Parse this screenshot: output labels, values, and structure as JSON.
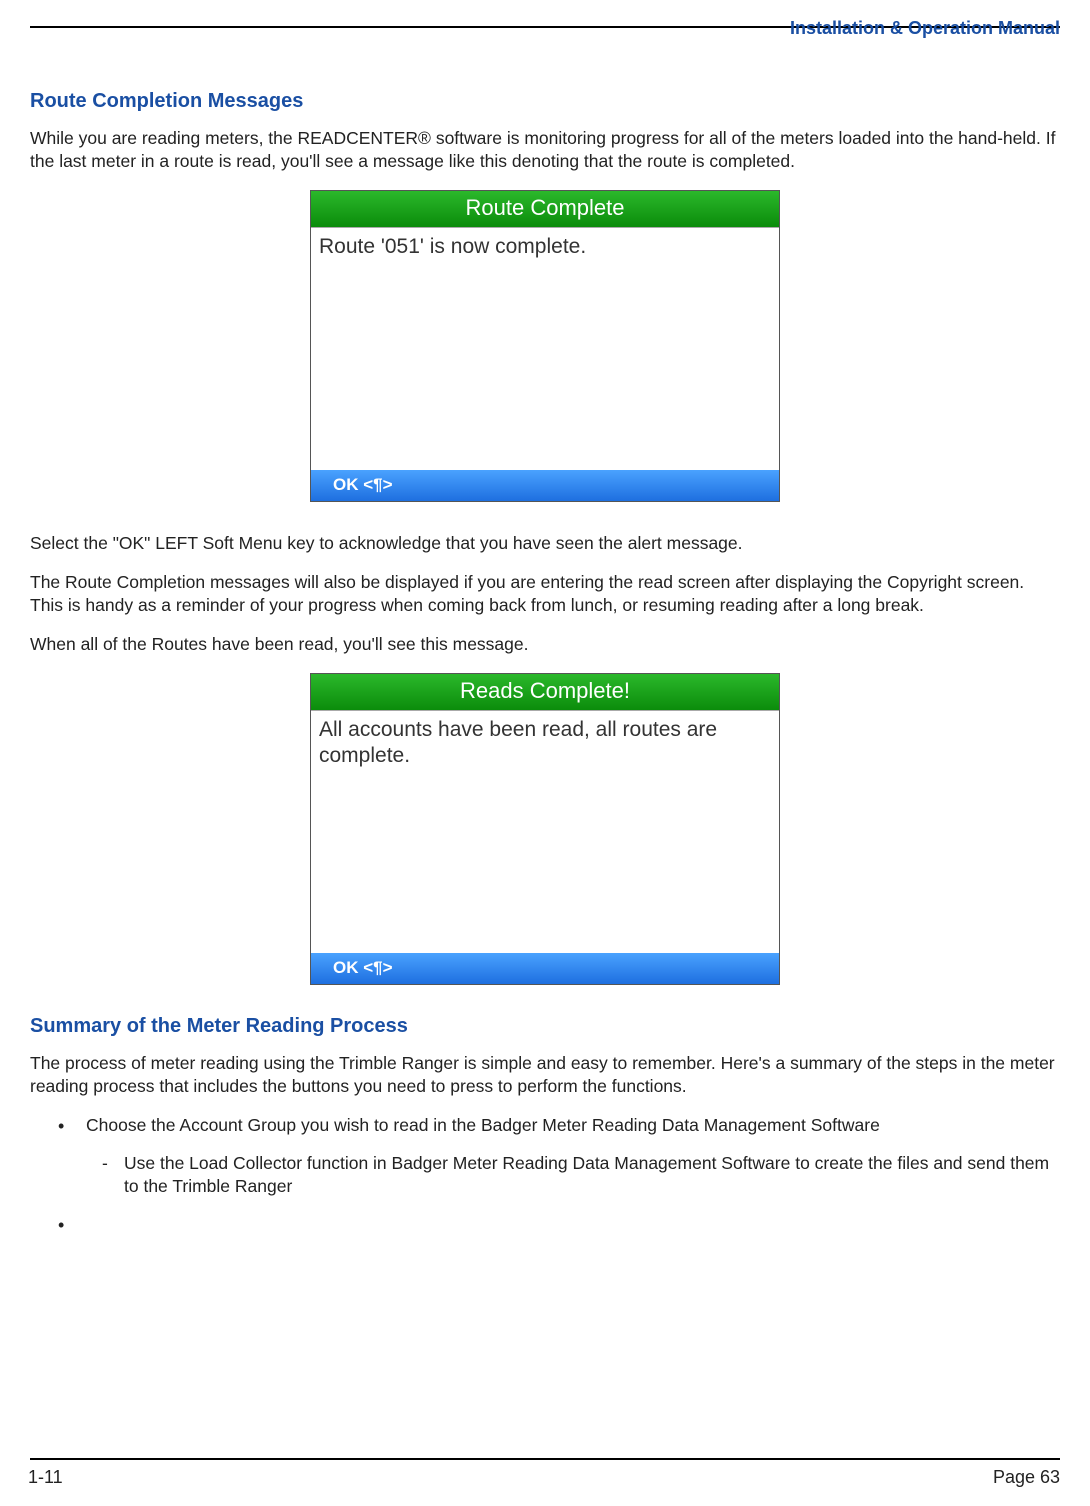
{
  "header": {
    "right_title": "Installation & Operation Manual"
  },
  "section1": {
    "heading": "Route Completion Messages",
    "para1": "While you are reading meters, the READCENTER® software is monitoring progress for all of the meters loaded into the hand-held.  If the last meter in a route is read, you'll see a message like this denoting that the route is completed.",
    "dialog1": {
      "title": "Route Complete",
      "body": "Route '051' is now complete.",
      "ok": "OK <¶>"
    },
    "para2": "Select the \"OK\" LEFT Soft Menu key to acknowledge that you have seen the alert message.",
    "para3": "The Route Completion messages will also be displayed if you are entering the read screen after displaying the Copyright screen.  This is handy as a reminder of your progress when coming back from lunch, or resuming reading after a long break.",
    "para4": "When all of the Routes have been read, you'll see this message.",
    "dialog2": {
      "title": "Reads Complete!",
      "body": "All accounts have been read, all routes are complete.",
      "ok": "OK <¶>"
    }
  },
  "section2": {
    "heading": "Summary of the Meter Reading Process",
    "para1": "The process of meter reading using the Trimble Ranger is simple and easy to remember.  Here's a summary of the steps in the meter reading process that includes the buttons you need to press to perform the functions.",
    "bullet1": "Choose the Account Group you wish to read in the Badger Meter Reading Data Management Software",
    "dash1": "Use the Load Collector function in Badger Meter Reading Data Management Software to create the files and send them to the Trimble Ranger",
    "bullet2": ""
  },
  "footer": {
    "left": "1-11",
    "right": "Page 63"
  }
}
